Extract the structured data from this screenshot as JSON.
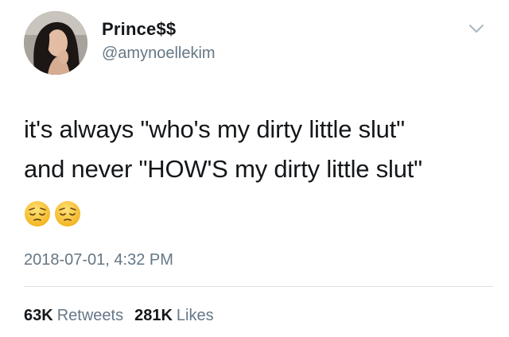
{
  "user": {
    "display_name": "Prince$$",
    "handle": "@amynoellekim"
  },
  "menu": {
    "icon": "chevron-down-icon"
  },
  "tweet": {
    "lines": [
      "it's always \"who's my dirty little slut\"",
      "and never \"HOW'S my dirty little slut\""
    ],
    "emojis": [
      "pensive-face-emoji",
      "pensive-face-emoji"
    ],
    "timestamp": "2018-07-01, 4:32 PM"
  },
  "stats": {
    "retweets_count": "63K",
    "retweets_label": "Retweets",
    "likes_count": "281K",
    "likes_label": "Likes"
  },
  "colors": {
    "text": "#14171a",
    "secondary": "#657786",
    "divider": "#dfe3e7",
    "emoji_face": "#f7c23a"
  }
}
